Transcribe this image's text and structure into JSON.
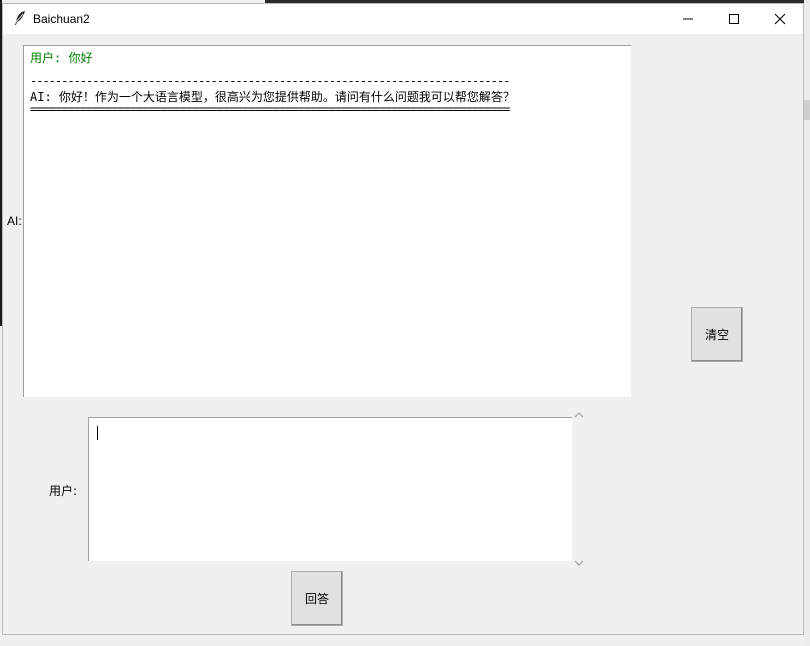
{
  "window": {
    "title": "Baichuan2",
    "icon": "feather-icon"
  },
  "labels": {
    "ai": "AI:",
    "user": "用户:"
  },
  "chat_log": {
    "user_message": "用户: 你好",
    "separator_dash": "-----------------------------------------------------------------------------",
    "ai_message": "AI: 你好！作为一个大语言模型，很高兴为您提供帮助。请问有什么问题我可以帮您解答？",
    "separator_equal": "=============================================================================",
    "user_text_color": "#008000"
  },
  "input": {
    "value": ""
  },
  "buttons": {
    "clear": "清空",
    "answer": "回答"
  }
}
